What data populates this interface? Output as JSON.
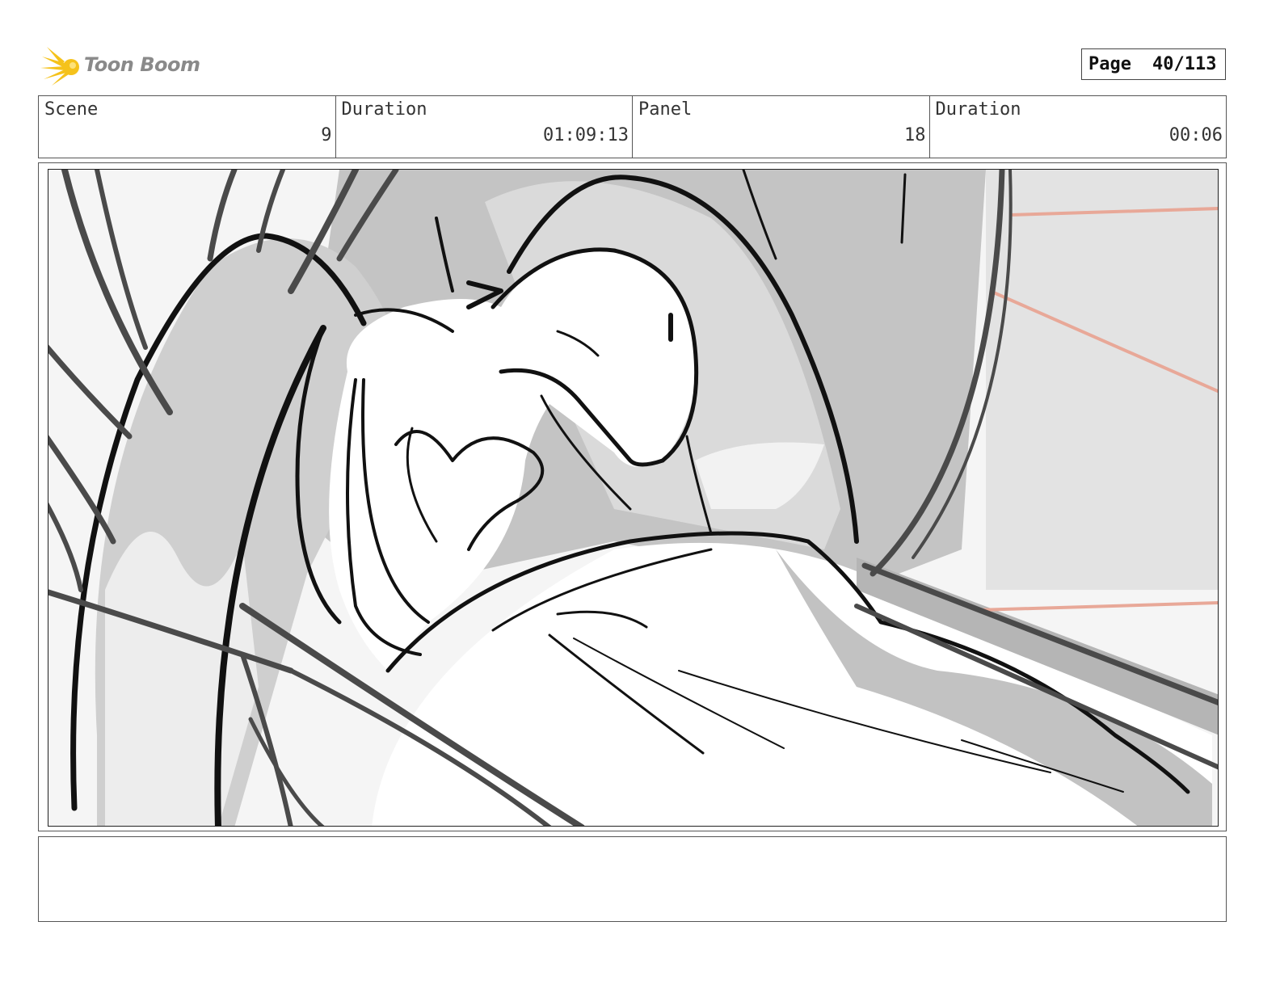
{
  "header": {
    "logo_text": "Toon Boom",
    "page_label": "Page",
    "page_number": "40/113"
  },
  "info": {
    "scene_label": "Scene",
    "scene_value": "9",
    "duration1_label": "Duration",
    "duration1_value": "01:09:13",
    "panel_label": "Panel",
    "panel_value": "18",
    "duration2_label": "Duration",
    "duration2_value": "00:06"
  },
  "notes": {
    "text": ""
  }
}
